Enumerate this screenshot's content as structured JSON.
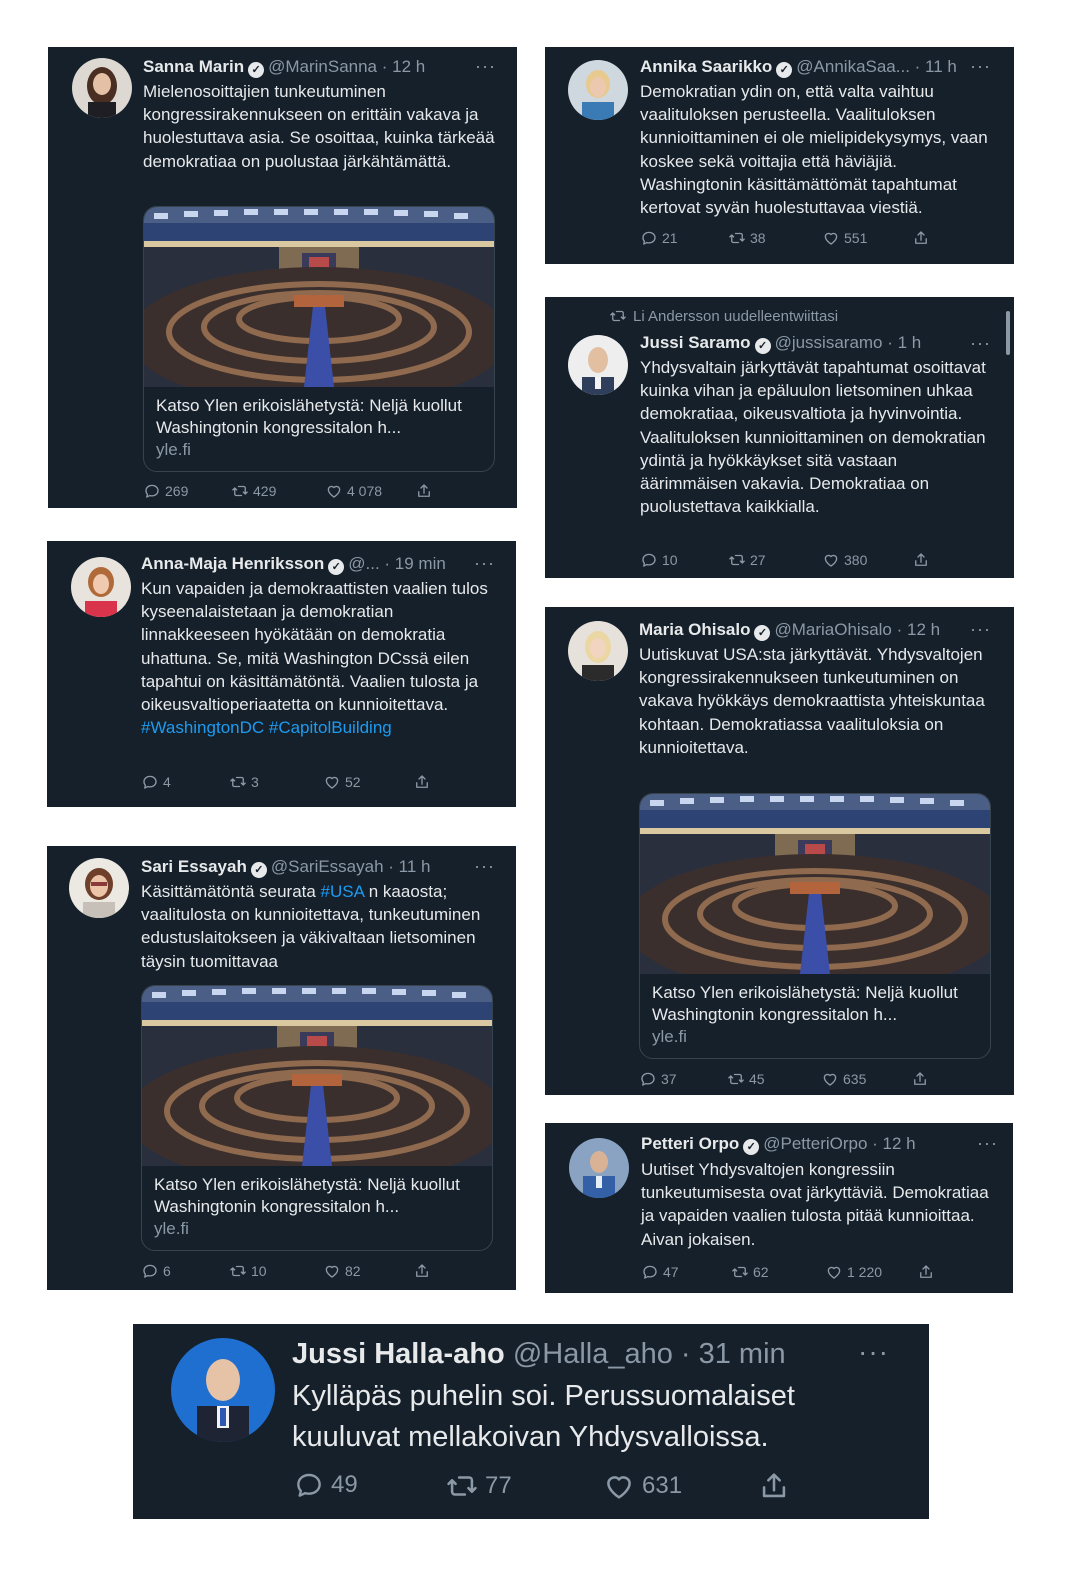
{
  "tweets": {
    "marin": {
      "name": "Sanna Marin",
      "handle": "@MarinSanna · 12 h",
      "text": "Mielenosoittajien tunkeutuminen kongressirakennukseen on erittäin vakava ja huolestuttava asia. Se osoittaa, kuinka tärkeää demokratiaa on puolustaa järkähtämättä.",
      "card_title": "Katso Ylen erikoislähetystä: Neljä kuollut Washingtonin kongressitalon h...",
      "card_host": "yle.fi",
      "replies": "269",
      "retweets": "429",
      "likes": "4 078"
    },
    "saarikko": {
      "name": "Annika Saarikko",
      "handle": "@AnnikaSaa... · 11 h",
      "text": "Demokratian ydin on, että valta vaihtuu vaalituloksen perusteella. Vaalituloksen kunnioittaminen ei ole mielipidekysymys, vaan koskee sekä voittajia että häviäjiä. Washingtonin käsittämättömät tapahtumat kertovat syvän huolestuttavaa viestiä.",
      "replies": "21",
      "retweets": "38",
      "likes": "551"
    },
    "saramo": {
      "retweet_note": "Li Andersson uudelleentwiittasi",
      "name": "Jussi Saramo",
      "handle": "@jussisaramo · 1 h",
      "text": "Yhdysvaltain järkyttävät tapahtumat osoittavat kuinka vihan ja epäluulon lietsominen uhkaa demokratiaa, oikeusvaltiota ja hyvinvointia. Vaalituloksen kunnioittaminen on demokratian ydintä ja hyökkäykset sitä vastaan äärimmäisen vakavia. Demokratiaa on puolustettava kaikkialla.",
      "replies": "10",
      "retweets": "27",
      "likes": "380"
    },
    "henriksson": {
      "name": "Anna-Maja Henriksson",
      "handle": "@... · 19 min",
      "text": "Kun vapaiden ja demokraattisten vaalien tulos kyseenalaistetaan ja demokratian linnakkeeseen hyökätään on demokratia uhattuna. Se, mitä Washington DCssä eilen tapahtui on käsittämätöntä. Vaalien tulosta ja oikeusvaltioperiaatetta on kunnioitettava.",
      "hashtags": "#WashingtonDC #CapitolBuilding",
      "replies": "4",
      "retweets": "3",
      "likes": "52"
    },
    "ohisalo": {
      "name": "Maria Ohisalo",
      "handle": "@MariaOhisalo · 12 h",
      "text": "Uutiskuvat USA:sta järkyttävät. Yhdysvaltojen kongressirakennukseen tunkeutuminen on vakava hyökkäys demokraattista yhteiskuntaa kohtaan. Demokratiassa vaalituloksia on kunnioitettava.",
      "card_title": "Katso Ylen erikoislähetystä: Neljä kuollut Washingtonin kongressitalon h...",
      "card_host": "yle.fi",
      "replies": "37",
      "retweets": "45",
      "likes": "635"
    },
    "essayah": {
      "name": "Sari Essayah",
      "handle": "@SariEssayah · 11 h",
      "text_before": "Käsittämätöntä seurata ",
      "hashtag": "#USA",
      "text_after": " n kaaosta; vaalitulosta on kunnioitettava, tunkeutuminen edustuslaitokseen ja väkivaltaan lietsominen täysin tuomittavaa",
      "card_title": "Katso Ylen erikoislähetystä: Neljä kuollut Washingtonin kongressitalon h...",
      "card_host": "yle.fi",
      "replies": "6",
      "retweets": "10",
      "likes": "82"
    },
    "orpo": {
      "name": "Petteri Orpo",
      "handle": "@PetteriOrpo · 12 h",
      "text": "Uutiset Yhdysvaltojen kongressiin tunkeutumisesta ovat järkyttäviä. Demokratiaa ja vapaiden vaalien tulosta pitää kunnioittaa. Aivan jokaisen.",
      "replies": "47",
      "retweets": "62",
      "likes": "1 220"
    },
    "hallaaho": {
      "name": "Jussi Halla-aho",
      "handle": "@Halla_aho · 31 min",
      "text": "Kylläpäs puhelin soi. Perussuomalaiset kuuluvat mellakoivan Yhdysvalloissa.",
      "replies": "49",
      "retweets": "77",
      "likes": "631"
    }
  },
  "icons": {
    "verified": "verified-check-icon",
    "more": "more-icon",
    "reply": "reply-icon",
    "retweet": "retweet-icon",
    "like": "heart-icon",
    "share": "share-icon"
  },
  "colors": {
    "tweet_bg": "#15202b",
    "text": "#e7e9ea",
    "secondary": "#8b98a5",
    "link": "#1d9bf0",
    "border": "#38444d",
    "page_bg": "#ffffff"
  }
}
